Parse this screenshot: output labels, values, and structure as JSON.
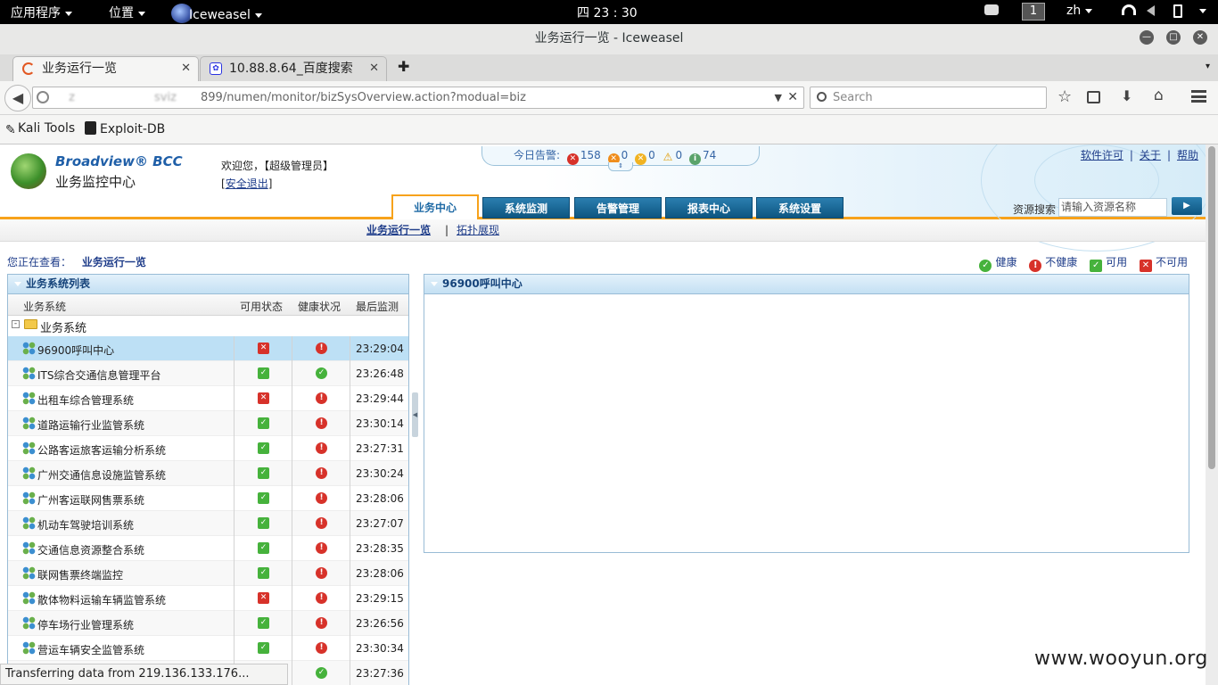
{
  "os_bar": {
    "apps": "应用程序",
    "places": "位置",
    "active_app": "Iceweasel",
    "clock": "四 23 : 30",
    "workspace": "1",
    "lang": "zh"
  },
  "window": {
    "title": "业务运行一览 - Iceweasel"
  },
  "browser": {
    "tabs": [
      {
        "label": "业务运行一览"
      },
      {
        "label": "10.88.8.64_百度搜索"
      }
    ],
    "url_host_a": " z",
    "url_host_b": "sviz",
    "url_path": "899/numen/monitor/bizSysOverview.action?modual=biz",
    "search_placeholder": "Search",
    "bookmarks": [
      {
        "label": "Kali Tools"
      },
      {
        "label": "Exploit-DB"
      }
    ],
    "status": "Transferring data from 219.136.133.176..."
  },
  "app": {
    "brand": "Broadview® BCC",
    "subtitle": "业务监控中心",
    "welcome": "欢迎您，【超级管理员】",
    "logout_prefix": "[",
    "logout": "安全退出",
    "logout_suffix": "]",
    "alarm_label": "今日告警:",
    "alarms": {
      "critical": "158",
      "major": "0",
      "minor": "0",
      "warning": "0",
      "info": "74"
    },
    "top_links": [
      "软件许可",
      "关于",
      "帮助"
    ],
    "top_sep": "|",
    "main_tabs": [
      "业务中心",
      "系统监测",
      "告警管理",
      "报表中心",
      "系统设置"
    ],
    "resource_search_label": "资源搜索",
    "resource_search_placeholder": "请输入资源名称",
    "sub_nav": [
      "业务运行一览",
      "拓扑展现"
    ],
    "sub_sep": "|",
    "viewing_label": "您正在查看：",
    "viewing_value": "业务运行一览",
    "legend": [
      "健康",
      "不健康",
      "可用",
      "不可用"
    ]
  },
  "left_panel": {
    "title": "业务系统列表",
    "columns": [
      "业务系统",
      "可用状态",
      "健康状况",
      "最后监测"
    ],
    "group": "业务系统",
    "rows": [
      {
        "name": "96900呼叫中心",
        "available": false,
        "healthy": false,
        "time": "23:29:04"
      },
      {
        "name": "ITS综合交通信息管理平台",
        "available": true,
        "healthy": true,
        "time": "23:26:48"
      },
      {
        "name": "出租车综合管理系统",
        "available": false,
        "healthy": false,
        "time": "23:29:44"
      },
      {
        "name": "道路运输行业监管系统",
        "available": true,
        "healthy": false,
        "time": "23:30:14"
      },
      {
        "name": "公路客运旅客运输分析系统",
        "available": true,
        "healthy": false,
        "time": "23:27:31"
      },
      {
        "name": "广州交通信息设施监管系统",
        "available": true,
        "healthy": false,
        "time": "23:30:24"
      },
      {
        "name": "广州客运联网售票系统",
        "available": true,
        "healthy": false,
        "time": "23:28:06"
      },
      {
        "name": "机动车驾驶培训系统",
        "available": true,
        "healthy": false,
        "time": "23:27:07"
      },
      {
        "name": "交通信息资源整合系统",
        "available": true,
        "healthy": false,
        "time": "23:28:35"
      },
      {
        "name": "联网售票终端监控",
        "available": true,
        "healthy": false,
        "time": "23:28:06"
      },
      {
        "name": "散体物料运输车辆监管系统",
        "available": false,
        "healthy": false,
        "time": "23:29:15"
      },
      {
        "name": "停车场行业管理系统",
        "available": true,
        "healthy": false,
        "time": "23:26:56"
      },
      {
        "name": "营运车辆安全监管系统",
        "available": true,
        "healthy": false,
        "time": "23:30:34"
      },
      {
        "name": "",
        "available": null,
        "healthy": true,
        "time": "23:27:36"
      }
    ]
  },
  "right_panel": {
    "title": "96900呼叫中心"
  },
  "watermark": "www.wooyun.org",
  "colors": {
    "accent_orange": "#f7a21b",
    "tab_blue": "#0d5580",
    "ok_green": "#46b23c",
    "err_red": "#d7322a",
    "selected_row": "#bde0f5"
  }
}
